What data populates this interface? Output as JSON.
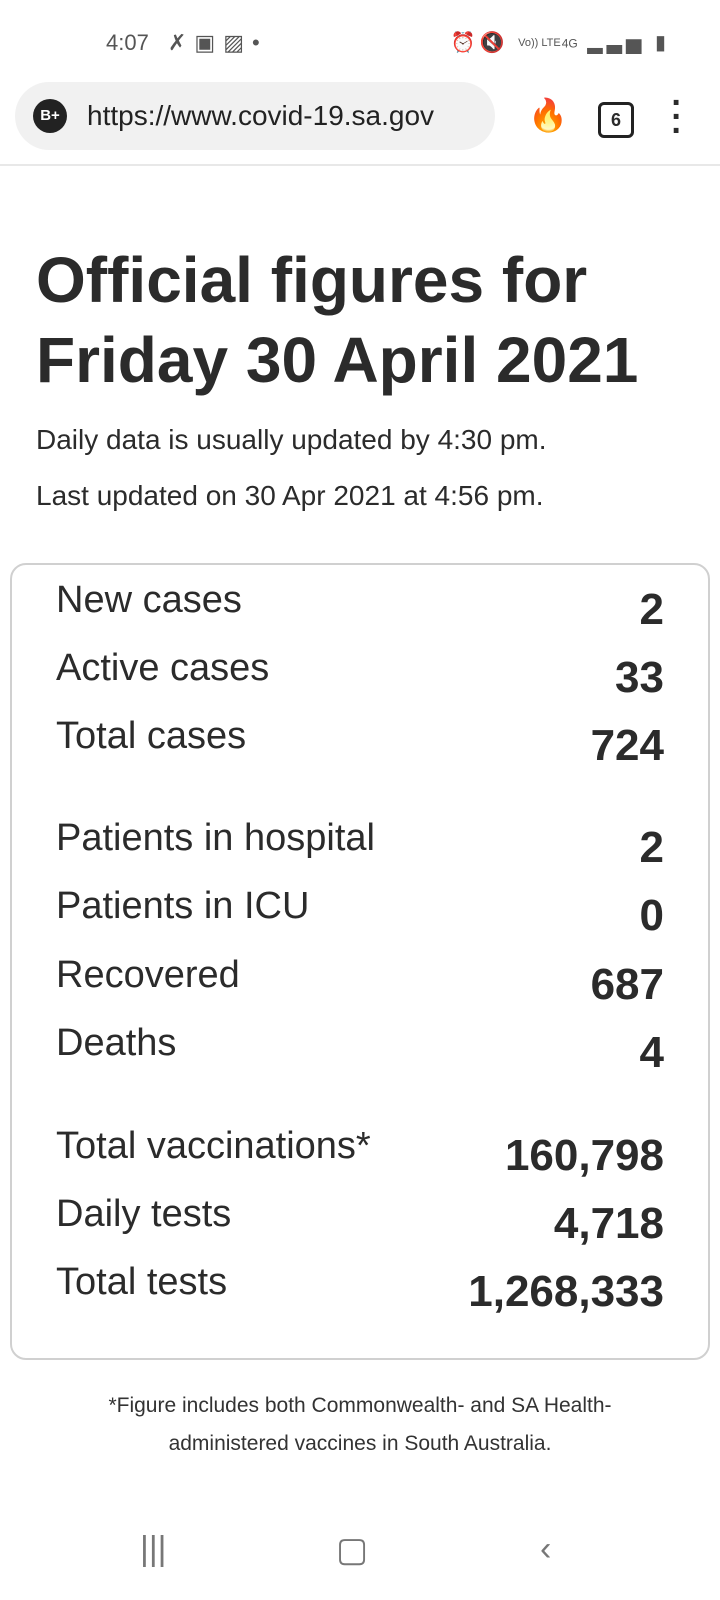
{
  "status_bar": {
    "time": "4:07",
    "left_icons": [
      "missed-call-icon",
      "outlook-icon",
      "image-icon",
      "dot-icon"
    ],
    "right_icons": [
      "alarm-icon",
      "mute-icon",
      "volte-icon",
      "4g-icon",
      "signal-icon",
      "battery-icon"
    ],
    "volte": "Vo)) LTE",
    "network": "4G"
  },
  "browser": {
    "url": "https://www.covid-19.sa.gov",
    "tab_count": "6",
    "badge": "B+"
  },
  "page": {
    "title": "Official figures for Friday 30 April 2021",
    "line1": "Daily data is usually updated by 4:30 pm.",
    "line2": "Last updated on 30 Apr 2021 at 4:56 pm."
  },
  "stats": [
    {
      "label": "New cases",
      "value": "2"
    },
    {
      "label": "Active cases",
      "value": "33"
    },
    {
      "label": "Total cases",
      "value": "724"
    },
    {
      "label": "Patients in hospital",
      "value": "2"
    },
    {
      "label": "Patients in ICU",
      "value": "0"
    },
    {
      "label": "Recovered",
      "value": "687"
    },
    {
      "label": "Deaths",
      "value": "4"
    },
    {
      "label": "Total vaccinations*",
      "value": "160,798"
    },
    {
      "label": "Daily tests",
      "value": "4,718"
    },
    {
      "label": "Total tests",
      "value": "1,268,333"
    }
  ],
  "footnote": {
    "line1": "*Figure includes both Commonwealth- and SA Health-",
    "line2": "administered vaccines in South Australia."
  }
}
